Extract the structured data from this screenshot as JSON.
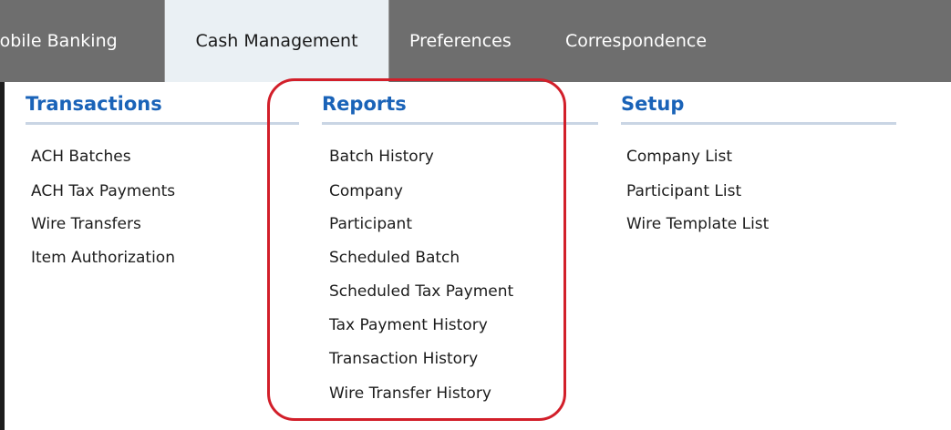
{
  "tabs": [
    {
      "label": "Iobile Banking",
      "active": false
    },
    {
      "label": "Cash Management",
      "active": true
    },
    {
      "label": "Preferences",
      "active": false
    },
    {
      "label": "Correspondence",
      "active": false
    }
  ],
  "columns": {
    "transactions": {
      "heading": "Transactions",
      "items": [
        "ACH Batches",
        "ACH Tax Payments",
        "Wire Transfers",
        "Item Authorization"
      ]
    },
    "reports": {
      "heading": "Reports",
      "items": [
        "Batch History",
        "Company",
        "Participant",
        "Scheduled Batch",
        "Scheduled Tax Payment",
        "Tax Payment History",
        "Transaction History",
        "Wire Transfer History"
      ]
    },
    "setup": {
      "heading": "Setup",
      "items": [
        "Company List",
        "Participant List",
        "Wire Template List"
      ]
    }
  },
  "colors": {
    "nav_bg": "#6e6e6e",
    "active_tab_bg": "#eaf0f4",
    "heading": "#1a63b8",
    "highlight": "#d21f2a"
  }
}
